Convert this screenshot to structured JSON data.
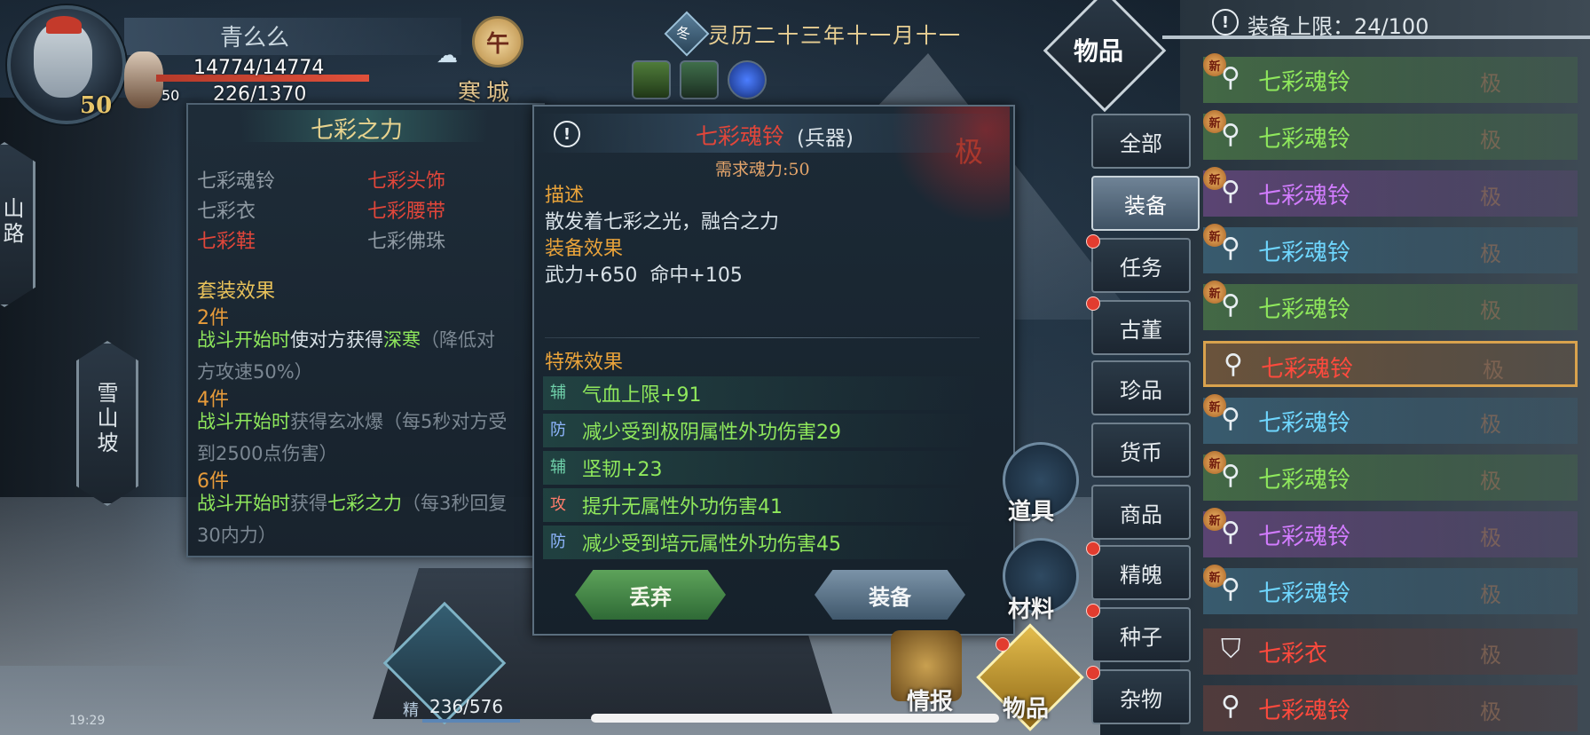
{
  "colors": {
    "accent_gold": "#e9d48f",
    "rarity_green": "#8fe85c",
    "rarity_purple": "#d27cff",
    "rarity_blue": "#6fd7ff",
    "rarity_red": "#ff4a3d"
  },
  "player": {
    "name": "青么么",
    "level": "50",
    "companion_level": "50",
    "hp": "14774/14774",
    "mp": "226/1370"
  },
  "world": {
    "time_emblem": "午",
    "location": "寒城",
    "season": "冬",
    "date": "灵历二十三年十一月十一"
  },
  "map": {
    "node_top": "山路",
    "node_main": "雪山坡"
  },
  "set_panel": {
    "title": "七彩之力",
    "pieces": [
      {
        "name": "七彩魂铃",
        "state": "owned"
      },
      {
        "name": "七彩头饰",
        "state": "missing"
      },
      {
        "name": "七彩衣",
        "state": "owned"
      },
      {
        "name": "七彩腰带",
        "state": "missing"
      },
      {
        "name": "七彩鞋",
        "state": "missing"
      },
      {
        "name": "七彩佛珠",
        "state": "owned"
      }
    ],
    "effects_title": "套装效果",
    "effects": [
      {
        "count": "2件",
        "lead": "战斗开始时",
        "mid": "使对方获得",
        "key": "深寒",
        "tail": "（降低对",
        "wrap": "方攻速50%）"
      },
      {
        "count": "4件",
        "lead": "战斗开始时",
        "mid": "获得玄冰爆（每5秒对方受",
        "key": "",
        "tail": "",
        "wrap": "到2500点伤害）"
      },
      {
        "count": "6件",
        "lead": "战斗开始时",
        "mid": "获得",
        "key": "七彩之力",
        "tail": "（每3秒回复",
        "wrap": "30内力）"
      }
    ]
  },
  "item_detail": {
    "name": "七彩魂铃",
    "type": "(兵器)",
    "grade": "极",
    "requirement": "需求魂力:50",
    "desc_title": "描述",
    "desc": "散发着七彩之光，融合之力",
    "equip_title": "装备效果",
    "equip_effect": "武力+650  命中+105",
    "special_title": "特殊效果",
    "affixes": [
      {
        "tag": "辅",
        "kind": "fu",
        "pre": "气血上限",
        "hl": "",
        "post": "",
        "val": "+91"
      },
      {
        "tag": "防",
        "kind": "fang",
        "pre": "减少受到",
        "hl": "极阴",
        "post": "属性外功伤害",
        "val": "29"
      },
      {
        "tag": "辅",
        "kind": "fu",
        "pre": "坚韧",
        "hl": "",
        "post": "",
        "val": "+23"
      },
      {
        "tag": "攻",
        "kind": "gong",
        "pre": "提升",
        "hl": "无",
        "post": "属性外功伤害",
        "val": "41"
      },
      {
        "tag": "防",
        "kind": "fang",
        "pre": "减少受到",
        "hl": "培元",
        "post": "属性外功伤害",
        "val": "45"
      }
    ],
    "discard_label": "丢弃",
    "equip_label": "装备"
  },
  "inventory": {
    "category_title": "物品",
    "limit_text": "装备上限：24/100",
    "tabs": [
      {
        "label": "全部",
        "active": false,
        "dot": false
      },
      {
        "label": "装备",
        "active": true,
        "dot": false
      },
      {
        "label": "任务",
        "active": false,
        "dot": true
      },
      {
        "label": "古董",
        "active": false,
        "dot": true
      },
      {
        "label": "珍品",
        "active": false,
        "dot": false
      },
      {
        "label": "货币",
        "active": false,
        "dot": false
      },
      {
        "label": "商品",
        "active": false,
        "dot": false
      },
      {
        "label": "精魄",
        "active": false,
        "dot": true
      },
      {
        "label": "种子",
        "active": false,
        "dot": true
      },
      {
        "label": "杂物",
        "active": false,
        "dot": true
      }
    ],
    "items": [
      {
        "name": "七彩魂铃",
        "rarity": "green",
        "new": true,
        "grade": "极",
        "icon": "bell-icon"
      },
      {
        "name": "七彩魂铃",
        "rarity": "green",
        "new": true,
        "grade": "极",
        "icon": "bell-icon"
      },
      {
        "name": "七彩魂铃",
        "rarity": "purple",
        "new": true,
        "grade": "极",
        "icon": "bell-icon"
      },
      {
        "name": "七彩魂铃",
        "rarity": "blue",
        "new": true,
        "grade": "极",
        "icon": "bell-icon"
      },
      {
        "name": "七彩魂铃",
        "rarity": "green",
        "new": true,
        "grade": "极",
        "icon": "bell-icon"
      },
      {
        "name": "七彩魂铃",
        "rarity": "red",
        "new": false,
        "grade": "极",
        "icon": "bell-icon",
        "selected": true
      },
      {
        "name": "七彩魂铃",
        "rarity": "blue",
        "new": true,
        "grade": "极",
        "icon": "bell-icon"
      },
      {
        "name": "七彩魂铃",
        "rarity": "green",
        "new": true,
        "grade": "极",
        "icon": "bell-icon"
      },
      {
        "name": "七彩魂铃",
        "rarity": "purple",
        "new": true,
        "grade": "极",
        "icon": "bell-icon"
      },
      {
        "name": "七彩魂铃",
        "rarity": "blue",
        "new": true,
        "grade": "极",
        "icon": "bell-icon"
      },
      {
        "name": "七彩衣",
        "rarity": "red",
        "new": false,
        "grade": "极",
        "icon": "robe-icon"
      },
      {
        "name": "七彩魂铃",
        "rarity": "red",
        "new": false,
        "grade": "极",
        "icon": "bell-icon"
      }
    ],
    "new_badge": "新"
  },
  "side_menu": {
    "props_label": "道具",
    "materials_label": "材料",
    "intel_label": "情报",
    "items_label": "物品"
  },
  "hud": {
    "stamina_label": "精",
    "stamina": "236/576",
    "clock": "19:29"
  }
}
